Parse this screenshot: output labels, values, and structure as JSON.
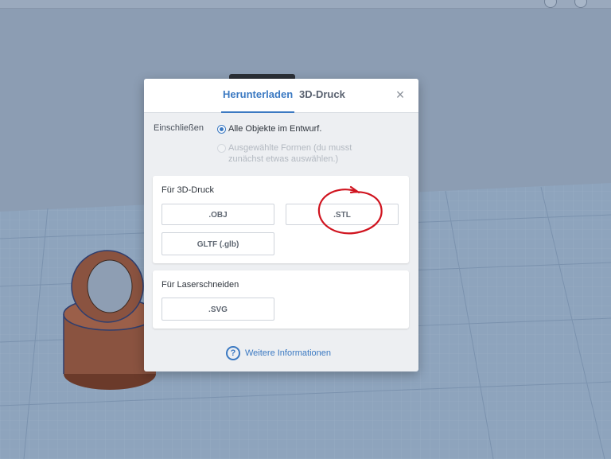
{
  "dialog": {
    "tabs": [
      {
        "label": "Herunterladen",
        "active": true
      },
      {
        "label": "3D-Druck",
        "active": false
      }
    ],
    "close_label": "×",
    "include_label": "Einschließen",
    "options": [
      {
        "label": "Alle Objekte im Entwurf.",
        "selected": true
      },
      {
        "label": "Ausgewählte Formen (du musst zunächst etwas auswählen.)",
        "selected": false,
        "disabled": true
      }
    ],
    "sections": [
      {
        "title": "Für 3D-Druck",
        "buttons": [
          ".OBJ",
          ".STL",
          "GLTF (.glb)"
        ]
      },
      {
        "title": "Für Laserschneiden",
        "buttons": [
          ".SVG"
        ]
      }
    ],
    "info_icon": "?",
    "info_link": "Weitere Informationen"
  },
  "colors": {
    "accent": "#3b79c2",
    "annotation": "#d0141f",
    "model": "#8a5340",
    "workplane": "#8fa6bf"
  },
  "icons": {
    "close": "close-icon",
    "info": "question-circle-icon"
  }
}
